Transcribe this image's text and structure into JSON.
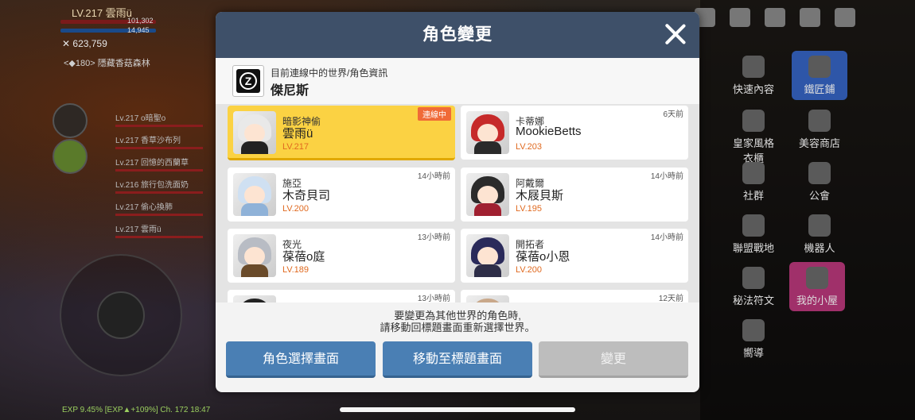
{
  "background": {
    "level_name": "LV.217 雲雨ü",
    "hp_value": "101,302",
    "mp_value": "14,945",
    "combat_power": "623,759",
    "map_name": "<◆180> 隱藏香菇森林",
    "party": [
      {
        "label": "Lv.217  o暗聖o"
      },
      {
        "label": "Lv.217  香草沙布列"
      },
      {
        "label": "Lv.217  回憶的西蘭草"
      },
      {
        "label": "Lv.216  旅行包洗面奶"
      },
      {
        "label": "Lv.217  偷心換肺"
      },
      {
        "label": "Lv.217  雲雨ü"
      }
    ],
    "menu": [
      {
        "label": "快速內容"
      },
      {
        "label": "鐵匠鋪"
      },
      {
        "label": "皇家風格\n衣櫃"
      },
      {
        "label": "美容商店"
      },
      {
        "label": "社群"
      },
      {
        "label": "公會"
      },
      {
        "label": "聯盟戰地"
      },
      {
        "label": "機器人"
      },
      {
        "label": "秘法符文"
      },
      {
        "label": "我的小屋"
      },
      {
        "label": "嚮導"
      }
    ],
    "exp_text": "EXP  9.45%   [EXP▲+109%]  Ch. 172  18:47"
  },
  "modal": {
    "title": "角色變更",
    "world_caption": "目前連線中的世界/角色資訊",
    "world_name": "傑尼斯",
    "characters": [
      {
        "job": "暗影神偷",
        "name": "雲雨ü",
        "level": "LV.217",
        "status": "連線中",
        "hair": "#e9e9e9",
        "body": "#222"
      },
      {
        "job": "卡蒂娜",
        "name": "MookieBetts",
        "level": "LV.203",
        "status": "6天前",
        "hair": "#c62a2a",
        "body": "#2a2a2a"
      },
      {
        "job": "施亞",
        "name": "木奇貝司",
        "level": "LV.200",
        "status": "14小時前",
        "hair": "#cfe0f2",
        "body": "#8fb2d8"
      },
      {
        "job": "阿戴爾",
        "name": "木屐貝斯",
        "level": "LV.195",
        "status": "14小時前",
        "hair": "#2b2b2b",
        "body": "#a02030"
      },
      {
        "job": "夜光",
        "name": "葆蓓o庭",
        "level": "LV.189",
        "status": "13小時前",
        "hair": "#b8bcc4",
        "body": "#6a4b2a"
      },
      {
        "job": "開拓者",
        "name": "葆蓓o小恩",
        "level": "LV.200",
        "status": "14小時前",
        "hair": "#2a2a5a",
        "body": "#2e2e48"
      },
      {
        "job": "",
        "name": "",
        "level": "",
        "status": "13小時前",
        "hair": "#222",
        "body": "#444"
      },
      {
        "job": "",
        "name": "",
        "level": "",
        "status": "12天前",
        "hair": "#c9a88a",
        "body": "#aaa"
      }
    ],
    "note_line1": "要變更為其他世界的角色時,",
    "note_line2": "請移動回標題畫面重新選擇世界。",
    "buttons": {
      "char_select": "角色選擇畫面",
      "title_screen": "移動至標題畫面",
      "change": "變更"
    }
  }
}
